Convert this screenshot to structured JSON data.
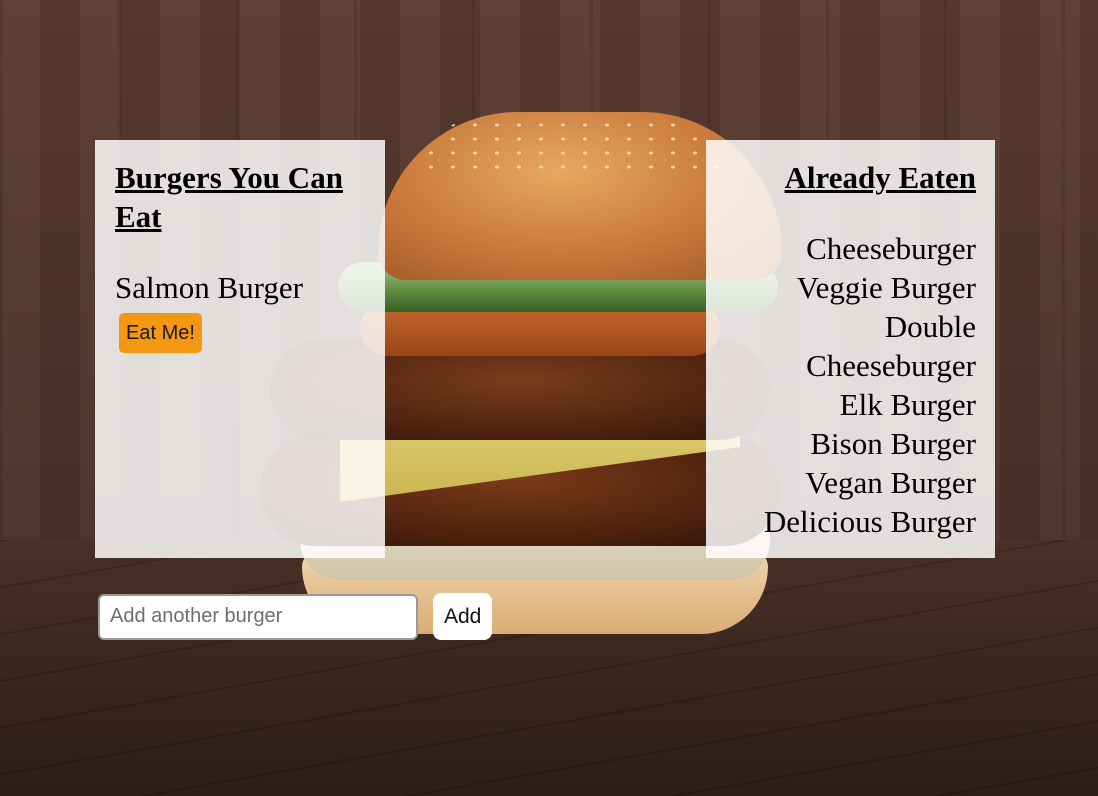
{
  "background": {
    "description_icon": "burger-photo",
    "wall_color": "#4d3228",
    "table_color": "#3a261e"
  },
  "left_panel": {
    "heading": "Burgers You Can Eat",
    "items": [
      {
        "name": "Salmon Burger",
        "button_label": "Eat Me!"
      }
    ]
  },
  "right_panel": {
    "heading": "Already Eaten",
    "items": [
      "Cheeseburger",
      "Veggie Burger",
      "Double Cheeseburger",
      "Elk Burger",
      "Bison Burger",
      "Vegan Burger",
      "Delicious Burger"
    ]
  },
  "form": {
    "input_value": "",
    "input_placeholder": "Add another burger",
    "submit_label": "Add"
  },
  "colors": {
    "eat_button": "#f29813",
    "panel_background": "rgba(255,255,255,0.84)"
  }
}
